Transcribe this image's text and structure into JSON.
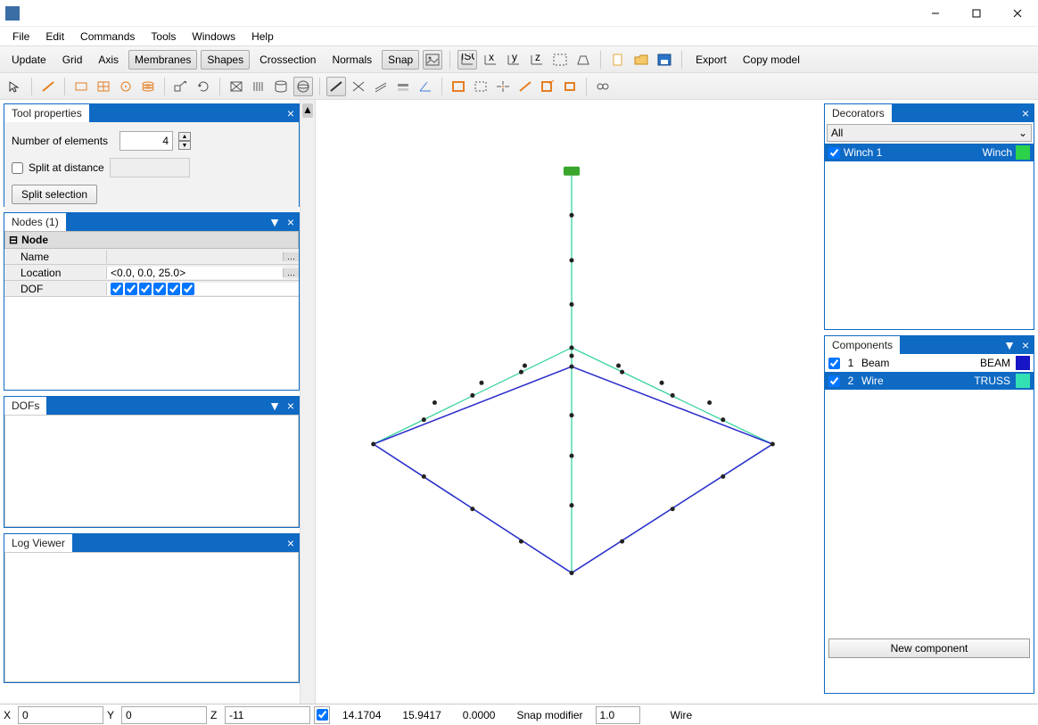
{
  "menu": {
    "file": "File",
    "edit": "Edit",
    "commands": "Commands",
    "tools": "Tools",
    "windows": "Windows",
    "help": "Help"
  },
  "toolbar1": {
    "update": "Update",
    "grid": "Grid",
    "axis": "Axis",
    "membranes": "Membranes",
    "shapes": "Shapes",
    "crossection": "Crossection",
    "normals": "Normals",
    "snap": "Snap",
    "export": "Export",
    "copy_model": "Copy model"
  },
  "panels": {
    "tool_properties": {
      "title": "Tool properties",
      "num_elements_label": "Number of elements",
      "num_elements_value": "4",
      "split_at_distance_label": "Split at distance",
      "split_at_distance_checked": false,
      "split_selection": "Split selection"
    },
    "nodes": {
      "title": "Nodes (1)",
      "header": "Node",
      "rows": {
        "name": {
          "label": "Name",
          "value": ""
        },
        "location": {
          "label": "Location",
          "value": "<0.0, 0.0, 25.0>"
        },
        "dof": {
          "label": "DOF",
          "checks": [
            true,
            true,
            true,
            true,
            true,
            true
          ]
        }
      }
    },
    "dofs": {
      "title": "DOFs"
    },
    "log": {
      "title": "Log Viewer"
    },
    "decorators": {
      "title": "Decorators",
      "all": "All",
      "items": [
        {
          "checked": true,
          "name": "Winch 1",
          "type": "Winch",
          "color": "#2bd24a",
          "selected": true
        }
      ]
    },
    "components": {
      "title": "Components",
      "items": [
        {
          "checked": true,
          "idx": "1",
          "name": "Beam",
          "type": "BEAM",
          "color": "#1616c6",
          "selected": false
        },
        {
          "checked": true,
          "idx": "2",
          "name": "Wire",
          "type": "TRUSS",
          "color": "#32e0b4",
          "selected": true
        }
      ],
      "new_component": "New component"
    }
  },
  "statusbar": {
    "x_label": "X",
    "x_value": "0",
    "y_label": "Y",
    "y_value": "0",
    "z_label": "Z",
    "z_value": "-11",
    "coord1": "14.1704",
    "coord2": "15.9417",
    "coord3": "0.0000",
    "snap_modifier_label": "Snap modifier",
    "snap_modifier_value": "1.0",
    "mode": "Wire"
  }
}
